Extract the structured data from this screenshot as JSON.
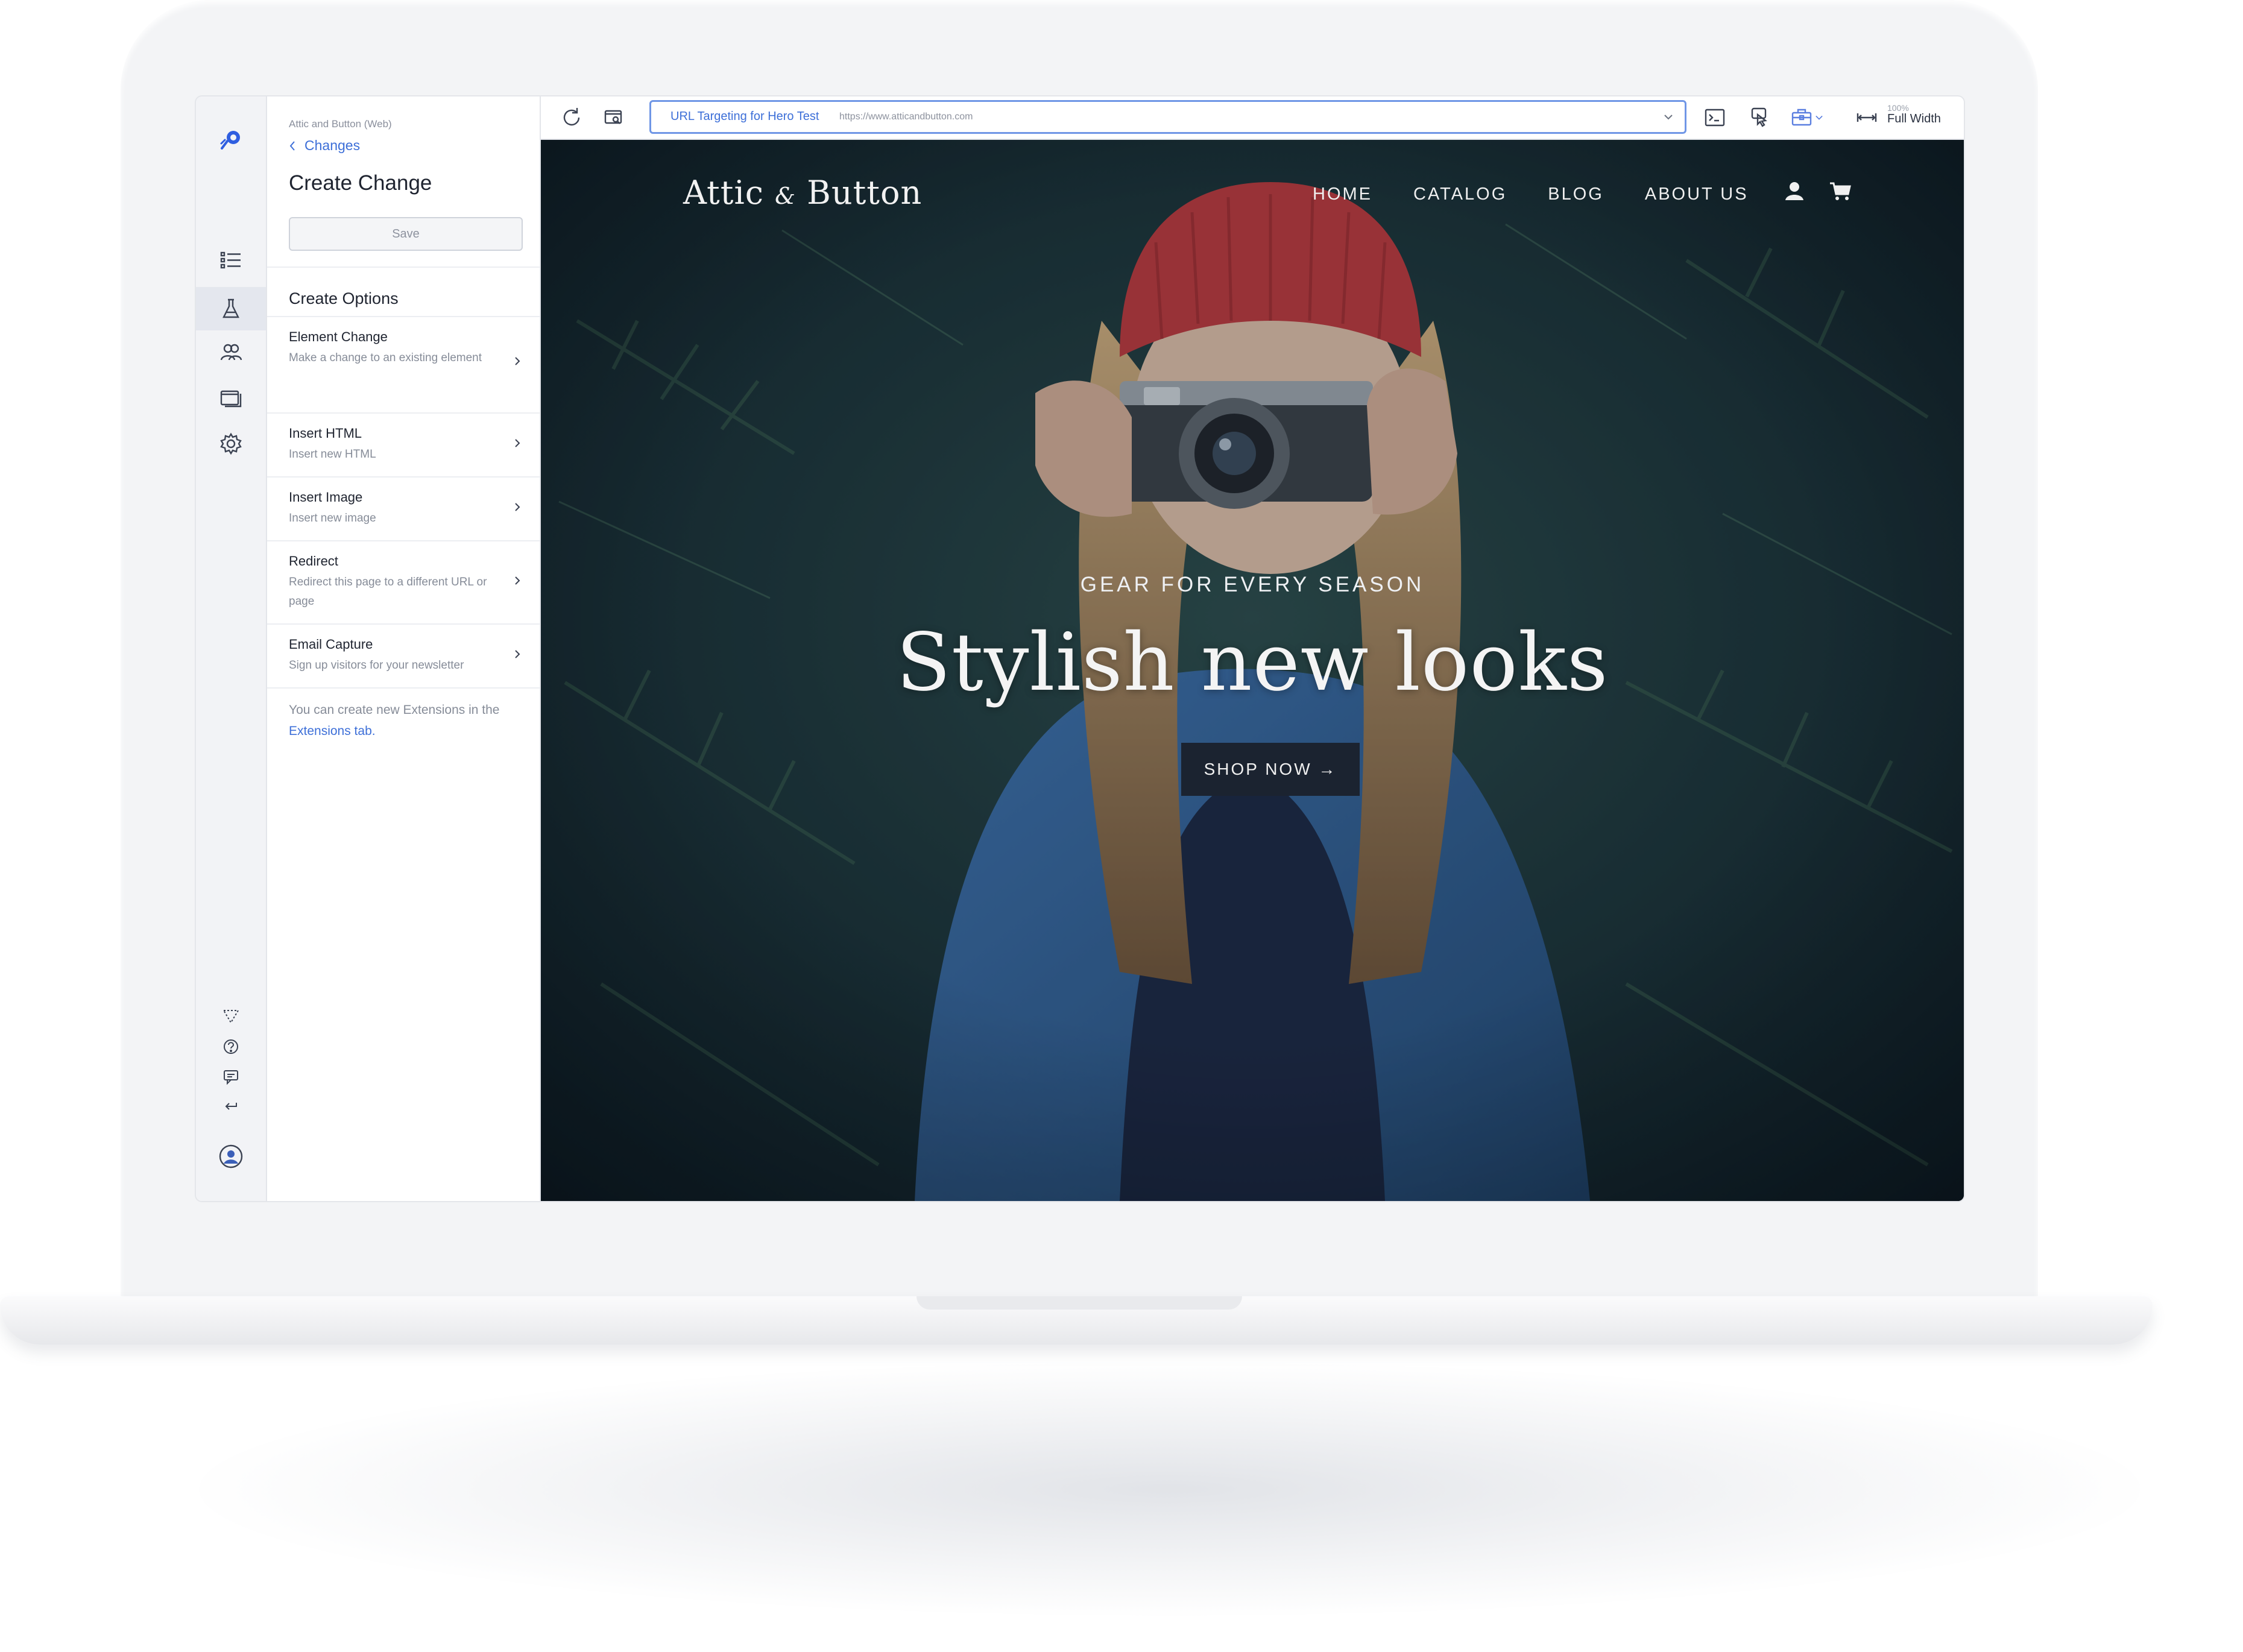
{
  "app": {
    "account": "Attic and Button (Web)",
    "back_label": "Changes",
    "panel_title": "Create Change",
    "save_label": "Save",
    "section_title": "Create Options",
    "options": [
      {
        "title": "Element Change",
        "desc": "Make a change to an existing element"
      },
      {
        "title": "Insert HTML",
        "desc": "Insert new HTML"
      },
      {
        "title": "Insert Image",
        "desc": "Insert new image"
      },
      {
        "title": "Redirect",
        "desc": "Redirect this page to a different URL or page"
      },
      {
        "title": "Email Capture",
        "desc": "Sign up visitors for your newsletter"
      }
    ],
    "note_text": "You can create new Extensions in the ",
    "note_link": "Extensions tab.",
    "rail_icons": [
      "logo-icon",
      "list-icon",
      "flask-icon",
      "audience-icon",
      "pages-icon",
      "gear-icon",
      "filter-icon",
      "help-icon",
      "feedback-icon",
      "return-icon",
      "user-avatar-icon"
    ]
  },
  "toolbar": {
    "url_name": "URL Targeting for Hero Test",
    "url_link": "https://www.atticandbutton.com",
    "zoom_pct": "100%",
    "width_mode": "Full Width",
    "icons": [
      "refresh-icon",
      "preview-icon",
      "code-editor-icon",
      "click-goals-icon",
      "extensions-icon",
      "width-icon"
    ]
  },
  "site": {
    "logo_left": "Attic",
    "logo_amp": "&",
    "logo_right": "Button",
    "nav": [
      "HOME",
      "CATALOG",
      "BLOG",
      "ABOUT US"
    ],
    "eyebrow": "GEAR FOR EVERY SEASON",
    "headline": "Stylish new looks",
    "cta": "SHOP NOW →"
  },
  "colors": {
    "accent": "#3d6fd8",
    "hero_dark": "#1c2b36",
    "button_dark": "#1b2330"
  }
}
